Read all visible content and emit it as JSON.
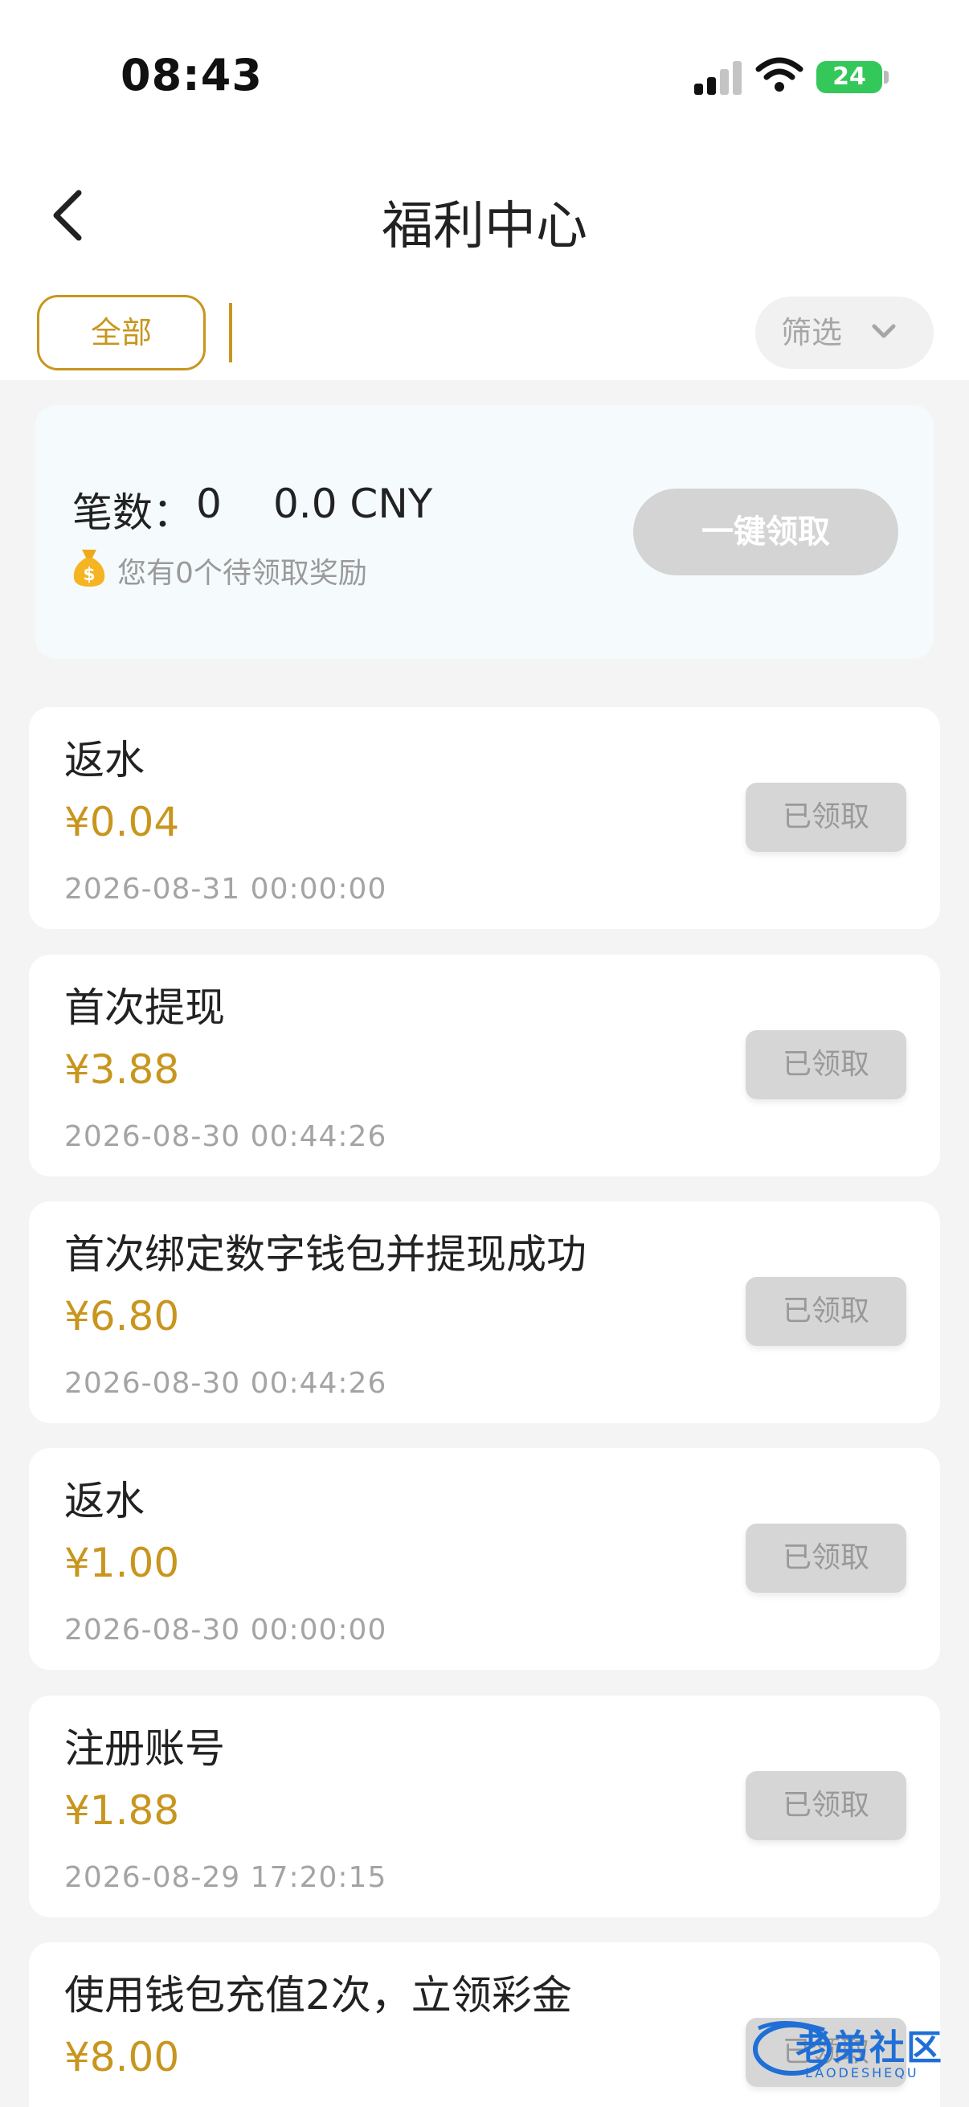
{
  "status_bar": {
    "time": "08:43",
    "battery": "24",
    "icons": [
      "cellular-signal-icon",
      "wifi-icon",
      "battery-icon"
    ]
  },
  "nav": {
    "title": "福利中心",
    "back_icon": "chevron-left-icon"
  },
  "tabs": {
    "all_label": "全部",
    "filter_label": "筛选",
    "filter_icon": "chevron-down-icon"
  },
  "summary": {
    "count_label": "笔数：",
    "count": "0",
    "amount": "0.0 CNY",
    "hint": "您有0个待领取奖励",
    "hint_icon": "money-bag-icon",
    "claim_all_label": "一键领取"
  },
  "rewards": [
    {
      "title": "返水",
      "amount": "¥0.04",
      "time": "2026-08-31 00:00:00",
      "status": "已领取"
    },
    {
      "title": "首次提现",
      "amount": "¥3.88",
      "time": "2026-08-30 00:44:26",
      "status": "已领取"
    },
    {
      "title": "首次绑定数字钱包并提现成功",
      "amount": "¥6.80",
      "time": "2026-08-30 00:44:26",
      "status": "已领取"
    },
    {
      "title": "返水",
      "amount": "¥1.00",
      "time": "2026-08-30 00:00:00",
      "status": "已领取"
    },
    {
      "title": "注册账号",
      "amount": "¥1.88",
      "time": "2026-08-29 17:20:15",
      "status": "已领取"
    },
    {
      "title": "使用钱包充值2次，立领彩金",
      "amount": "¥8.00",
      "time": "",
      "status": "已领取"
    }
  ],
  "watermark": {
    "text": "老弟社区",
    "sub": "LAODESHEQU"
  },
  "colors": {
    "accent": "#c8961e",
    "page_bg": "#f4f4f4",
    "summary_bg": "#f5fbfd",
    "disabled_button": "#d6d6d6",
    "battery_green": "#34c759"
  }
}
